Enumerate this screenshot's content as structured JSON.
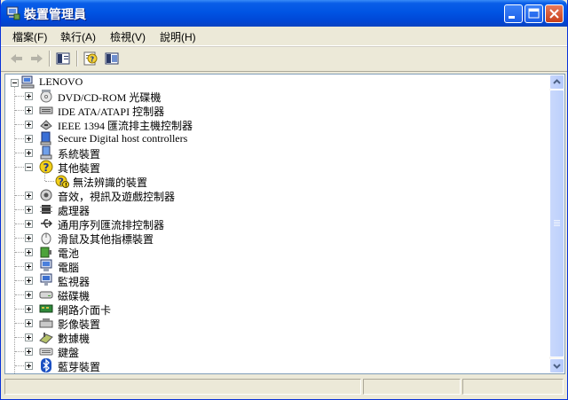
{
  "window": {
    "title": "裝置管理員"
  },
  "menu": {
    "items": [
      "檔案(F)",
      "執行(A)",
      "檢視(V)",
      "說明(H)"
    ]
  },
  "tree": {
    "root": "LENOVO",
    "categories": [
      {
        "label": "DVD/CD-ROM 光碟機",
        "icon": "cdrom-icon",
        "expanded": false
      },
      {
        "label": "IDE ATA/ATAPI 控制器",
        "icon": "ide-controller-icon",
        "expanded": false
      },
      {
        "label": "IEEE 1394 匯流排主機控制器",
        "icon": "ieee1394-icon",
        "expanded": false
      },
      {
        "label": "Secure Digital host controllers",
        "icon": "sd-controller-icon",
        "expanded": false
      },
      {
        "label": "系統裝置",
        "icon": "system-device-icon",
        "expanded": false
      },
      {
        "label": "其他裝置",
        "icon": "question-mark-icon",
        "expanded": true,
        "children": [
          "無法辨識的裝置"
        ]
      },
      {
        "label": "音效，視訊及遊戲控制器",
        "icon": "sound-icon",
        "expanded": false
      },
      {
        "label": "處理器",
        "icon": "processor-icon",
        "expanded": false
      },
      {
        "label": "通用序列匯流排控制器",
        "icon": "usb-icon",
        "expanded": false
      },
      {
        "label": "滑鼠及其他指標裝置",
        "icon": "mouse-icon",
        "expanded": false
      },
      {
        "label": "電池",
        "icon": "battery-icon",
        "expanded": false
      },
      {
        "label": "電腦",
        "icon": "computer-icon",
        "expanded": false
      },
      {
        "label": "監視器",
        "icon": "monitor-icon",
        "expanded": false
      },
      {
        "label": "磁碟機",
        "icon": "disk-drive-icon",
        "expanded": false
      },
      {
        "label": "網路介面卡",
        "icon": "network-adapter-icon",
        "expanded": false
      },
      {
        "label": "影像裝置",
        "icon": "imaging-device-icon",
        "expanded": false
      },
      {
        "label": "數據機",
        "icon": "modem-icon",
        "expanded": false
      },
      {
        "label": "鍵盤",
        "icon": "keyboard-icon",
        "expanded": false
      },
      {
        "label": "藍芽裝置",
        "icon": "bluetooth-icon",
        "expanded": false
      }
    ]
  },
  "colors": {
    "titlebar": "#0054e3",
    "face": "#ece9d8",
    "border": "#7f9db9"
  }
}
